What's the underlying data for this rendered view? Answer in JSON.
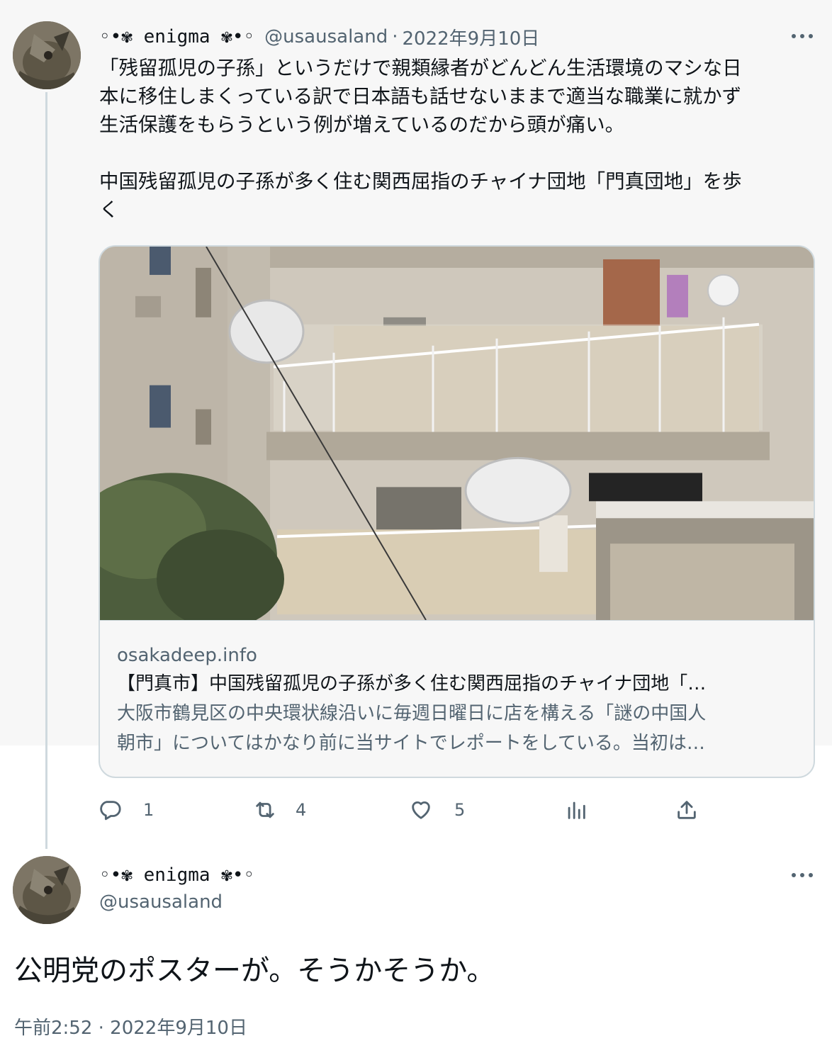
{
  "parent_tweet": {
    "display_name": "◦•✾ enigma ✾•◦",
    "handle": "@usausaland",
    "separator": "·",
    "date": "2022年9月10日",
    "more_label": "…",
    "text": "「残留孤児の子孫」というだけで親類縁者がどんどん生活環境のマシな日\n本に移住しまくっている訳で日本語も話せないままで適当な職業に就かず\n生活保護をもらうという例が増えているのだから頭が痛い。\n\n中国残留孤児の子孫が多く住む関西屈指のチャイナ団地「門真団地」を歩\nく",
    "card": {
      "domain": "osakadeep.info",
      "title": "【門真市】中国残留孤児の子孫が多く住む関西屈指のチャイナ団地「…",
      "description_line1": "大阪市鶴見区の中央環状線沿いに毎週日曜日に店を構える「謎の中国人",
      "description_line2": "朝市」についてはかなり前に当サイトでレポートをしている。当初は…"
    },
    "actions": {
      "reply_count": "1",
      "retweet_count": "4",
      "like_count": "5"
    }
  },
  "reply_tweet": {
    "display_name": "◦•✾ enigma ✾•◦",
    "handle": "@usausaland",
    "more_label": "…",
    "text": "公明党のポスターが。そうかそうか。",
    "timestamp": "午前2:52 · 2022年9月10日"
  },
  "icons": {
    "reply": "reply-icon",
    "retweet": "retweet-icon",
    "like": "heart-icon",
    "views": "analytics-icon",
    "share": "share-icon",
    "more": "more-icon"
  },
  "colors": {
    "text_primary": "#0f1419",
    "text_secondary": "#536471",
    "border": "#cfd9de",
    "parent_background": "#f7f7f7"
  }
}
